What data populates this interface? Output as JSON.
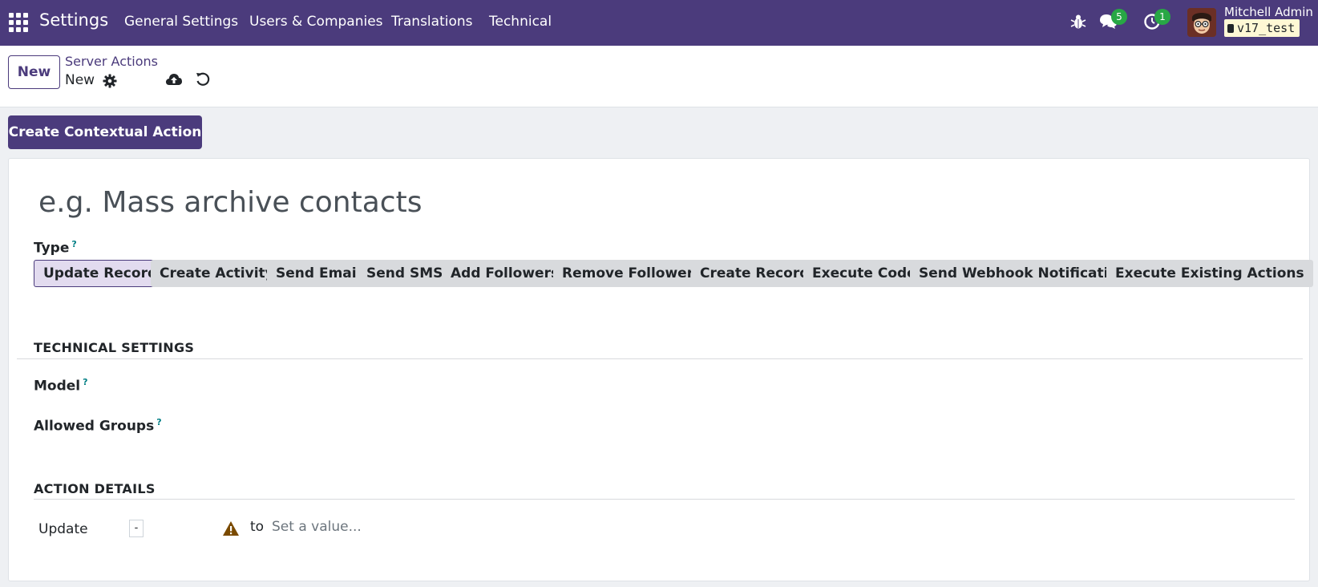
{
  "navbar": {
    "app_name": "Settings",
    "menu": [
      "General Settings",
      "Users & Companies",
      "Translations",
      "Technical"
    ],
    "messages_count": "5",
    "activities_count": "1",
    "user_name": "Mitchell Admin",
    "database": "v17_test",
    "accent_color": "#4b3b7c"
  },
  "control_panel": {
    "new_label": "New",
    "breadcrumb_parent": "Server Actions",
    "breadcrumb_current": "New"
  },
  "action_bar": {
    "contextual_action_label": "Create Contextual Action"
  },
  "form": {
    "name_placeholder": "e.g. Mass archive contacts",
    "type_label": "Type",
    "help_marker": "?",
    "types": [
      "Update Record",
      "Create Activity",
      "Send Email",
      "Send SMS",
      "Add Followers",
      "Remove Followers",
      "Create Record",
      "Execute Code",
      "Send Webhook Notification",
      "Execute Existing Actions"
    ],
    "selected_type": "Update Record",
    "technical_settings_title": "TECHNICAL SETTINGS",
    "model_label": "Model",
    "allowed_groups_label": "Allowed Groups",
    "action_details_title": "ACTION DETAILS",
    "update_label": "Update",
    "field_dash": "-",
    "to_label": "to",
    "value_placeholder": "Set a value..."
  }
}
